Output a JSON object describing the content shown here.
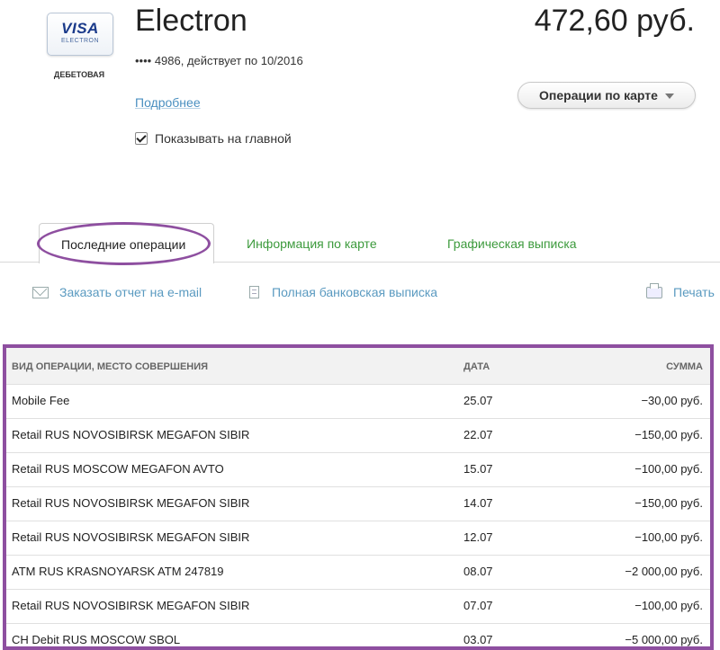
{
  "card": {
    "brand_main": "VISA",
    "brand_sub": "ELECTRON",
    "type": "ДЕБЕТОВАЯ",
    "title": "Electron",
    "balance": "472,60 руб.",
    "number_info": "•••• 4986, действует по 10/2016",
    "details_link": "Подробнее",
    "ops_button": "Операции по карте",
    "show_on_main": "Показывать на главной",
    "show_on_main_checked": true
  },
  "tabs": [
    {
      "label": "Последние операции",
      "active": true
    },
    {
      "label": "Информация по карте",
      "active": false
    },
    {
      "label": "Графическая выписка",
      "active": false
    }
  ],
  "actions": {
    "email_report": "Заказать отчет на e-mail",
    "full_statement": "Полная банковская выписка",
    "print": "Печать"
  },
  "table": {
    "columns": [
      "ВИД ОПЕРАЦИИ, МЕСТО СОВЕРШЕНИЯ",
      "ДАТА",
      "СУММА"
    ],
    "rows": [
      {
        "desc": "Mobile Fee",
        "date": "25.07",
        "sum": "−30,00 руб."
      },
      {
        "desc": "Retail RUS NOVOSIBIRSK MEGAFON SIBIR",
        "date": "22.07",
        "sum": "−150,00 руб."
      },
      {
        "desc": "Retail RUS MOSCOW MEGAFON AVTO",
        "date": "15.07",
        "sum": "−100,00 руб."
      },
      {
        "desc": "Retail RUS NOVOSIBIRSK MEGAFON SIBIR",
        "date": "14.07",
        "sum": "−150,00 руб."
      },
      {
        "desc": "Retail RUS NOVOSIBIRSK MEGAFON SIBIR",
        "date": "12.07",
        "sum": "−100,00 руб."
      },
      {
        "desc": "ATM RUS KRASNOYARSK ATM 247819",
        "date": "08.07",
        "sum": "−2 000,00 руб."
      },
      {
        "desc": "Retail RUS NOVOSIBIRSK MEGAFON SIBIR",
        "date": "07.07",
        "sum": "−100,00 руб."
      },
      {
        "desc": "CH Debit RUS MOSCOW SBOL",
        "date": "03.07",
        "sum": "−5 000,00 руб."
      }
    ]
  },
  "colors": {
    "highlight": "#8e4fa0",
    "tab_link": "#3c9a3c",
    "action_link": "#5a9ac0"
  }
}
